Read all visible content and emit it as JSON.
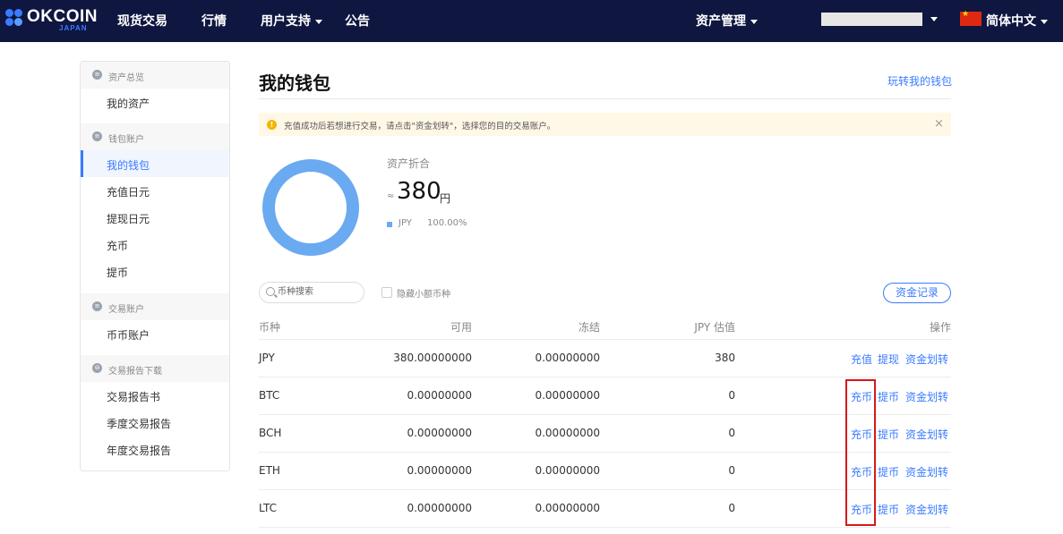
{
  "nav": {
    "brand": "OKCOIN",
    "brand_sub": "JAPAN",
    "items": [
      "现货交易",
      "行情",
      "用户支持",
      "公告"
    ],
    "asset_mgmt": "资产管理",
    "language": "简体中文"
  },
  "sidebar": {
    "groups": [
      {
        "label": "资产总览",
        "items": [
          "我的资产"
        ]
      },
      {
        "label": "钱包账户",
        "items": [
          "我的钱包",
          "充值日元",
          "提现日元",
          "充币",
          "提币"
        ]
      },
      {
        "label": "交易账户",
        "items": [
          "币币账户"
        ]
      },
      {
        "label": "交易报告下载",
        "items": [
          "交易报告书",
          "季度交易报告",
          "年度交易报告"
        ]
      }
    ],
    "active": "我的钱包"
  },
  "page": {
    "title": "我的钱包",
    "help_link": "玩转我的钱包",
    "notice": "充值成功后若想进行交易，请点击\"资金划转\"，选择您的目的交易账户。",
    "close": "×"
  },
  "summary": {
    "label": "资产折合",
    "approx": "≈",
    "value": "380",
    "unit": "円",
    "legend": [
      {
        "name": "JPY",
        "pct": "100.00%",
        "color": "#6aaaf0"
      }
    ]
  },
  "toolbar": {
    "search_placeholder": "币种搜索",
    "hide_small": "隐藏小额币种",
    "record_button": "资金记录"
  },
  "table": {
    "headers": [
      "币种",
      "可用",
      "冻结",
      "JPY 估值",
      "操作"
    ],
    "rows": [
      {
        "currency": "JPY",
        "available": "380.00000000",
        "frozen": "0.00000000",
        "jpy_value": "380",
        "actions": [
          "充值",
          "提现",
          "资金划转"
        ]
      },
      {
        "currency": "BTC",
        "available": "0.00000000",
        "frozen": "0.00000000",
        "jpy_value": "0",
        "actions": [
          "充币",
          "提币",
          "资金划转"
        ]
      },
      {
        "currency": "BCH",
        "available": "0.00000000",
        "frozen": "0.00000000",
        "jpy_value": "0",
        "actions": [
          "充币",
          "提币",
          "资金划转"
        ]
      },
      {
        "currency": "ETH",
        "available": "0.00000000",
        "frozen": "0.00000000",
        "jpy_value": "0",
        "actions": [
          "充币",
          "提币",
          "资金划转"
        ]
      },
      {
        "currency": "LTC",
        "available": "0.00000000",
        "frozen": "0.00000000",
        "jpy_value": "0",
        "actions": [
          "充币",
          "提币",
          "资金划转"
        ]
      }
    ]
  },
  "colors": {
    "nav_bg": "#0f1640",
    "accent": "#3a7bff",
    "highlight": "#d41a1a"
  }
}
